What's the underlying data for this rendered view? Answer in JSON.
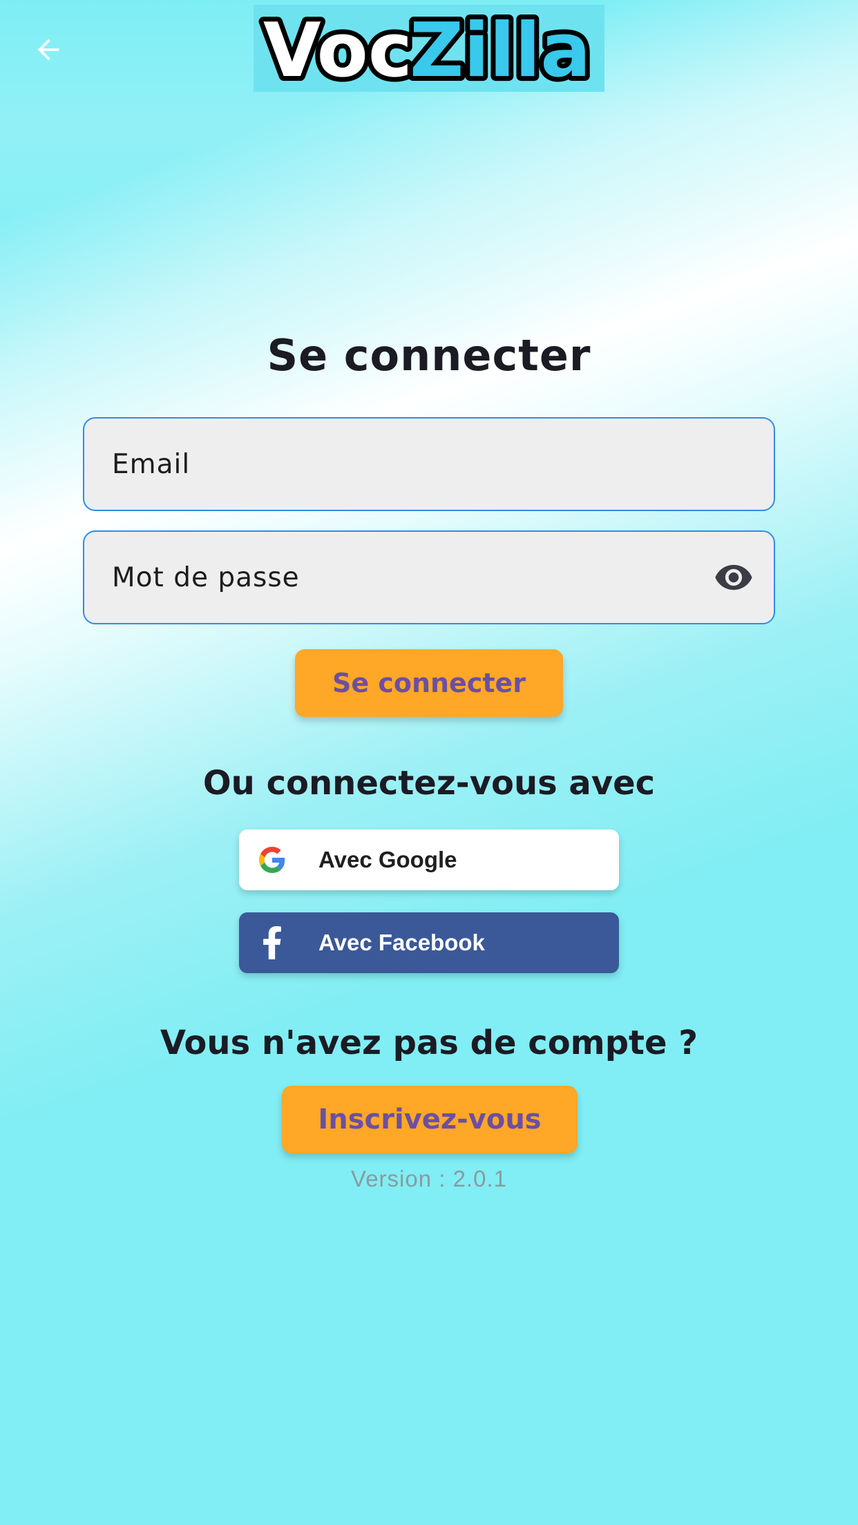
{
  "app": {
    "logo_text_dark": "Voc",
    "logo_text_accent": "Zilla",
    "colors": {
      "background": "#80eef4",
      "accent_orange": "#ffa726",
      "button_text_purple": "#6c4fa3",
      "field_border": "#2f8de4",
      "facebook_blue": "#3b5998",
      "logo_accent": "#38c9ec"
    }
  },
  "header": {
    "back_icon": "arrow-left-icon"
  },
  "login": {
    "title": "Se connecter",
    "email_placeholder": "Email",
    "password_placeholder": "Mot de passe",
    "password_toggle_icon": "eye-icon",
    "submit_label": "Se connecter"
  },
  "social": {
    "heading": "Ou connectez-vous avec",
    "google_label": "Avec Google",
    "google_icon": "google-icon",
    "facebook_label": "Avec Facebook",
    "facebook_icon": "facebook-icon"
  },
  "signup": {
    "heading": "Vous n'avez pas de compte ?",
    "button_label": "Inscrivez-vous"
  },
  "footer": {
    "version": "Version : 2.0.1"
  }
}
